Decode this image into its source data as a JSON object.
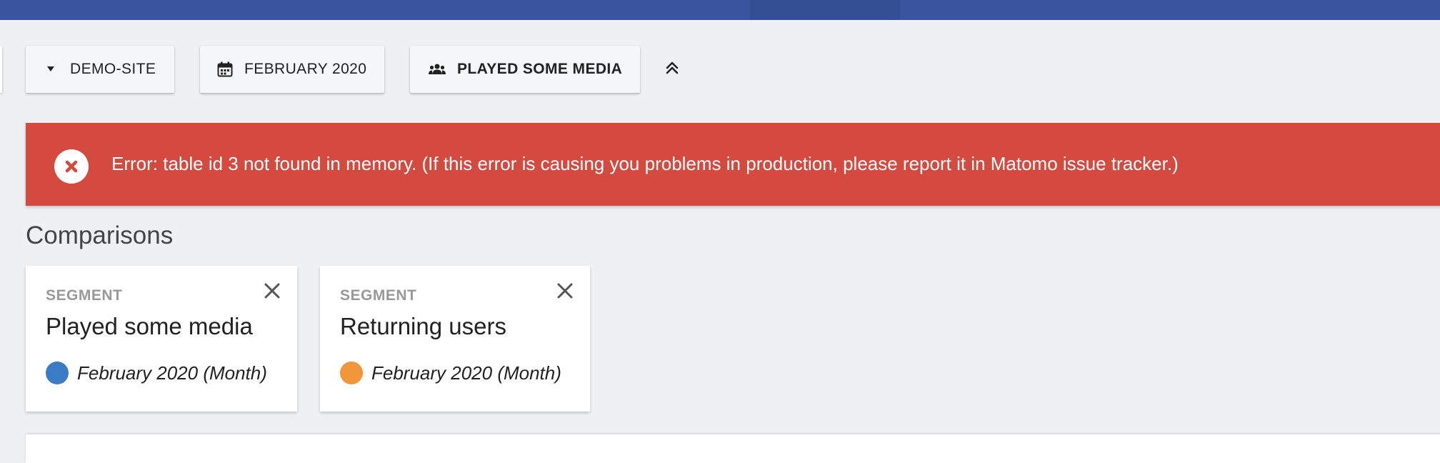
{
  "toolbar": {
    "site_label": "DEMO-SITE",
    "date_label": "FEBRUARY 2020",
    "segment_label": "PLAYED SOME MEDIA"
  },
  "error": {
    "message": "Error: table id 3 not found in memory. (If this error is causing you problems in production, please report it in Matomo issue tracker.)"
  },
  "comparisons": {
    "heading": "Comparisons",
    "cards": [
      {
        "kind": "SEGMENT",
        "title": "Played some media",
        "period": "February 2020 (Month)",
        "color": "#3b7cc4"
      },
      {
        "kind": "SEGMENT",
        "title": "Returning users",
        "period": "February 2020 (Month)",
        "color": "#f0953a"
      }
    ]
  },
  "icons": {
    "site": "caret-down-icon",
    "date": "calendar-icon",
    "segment": "users-icon",
    "collapse": "chevron-double-up-icon",
    "error": "error-x-icon",
    "close": "close-icon"
  },
  "colors": {
    "topbar": "#3a55a0",
    "error": "#d44a3f",
    "series1": "#3b7cc4",
    "series2": "#f0953a"
  }
}
